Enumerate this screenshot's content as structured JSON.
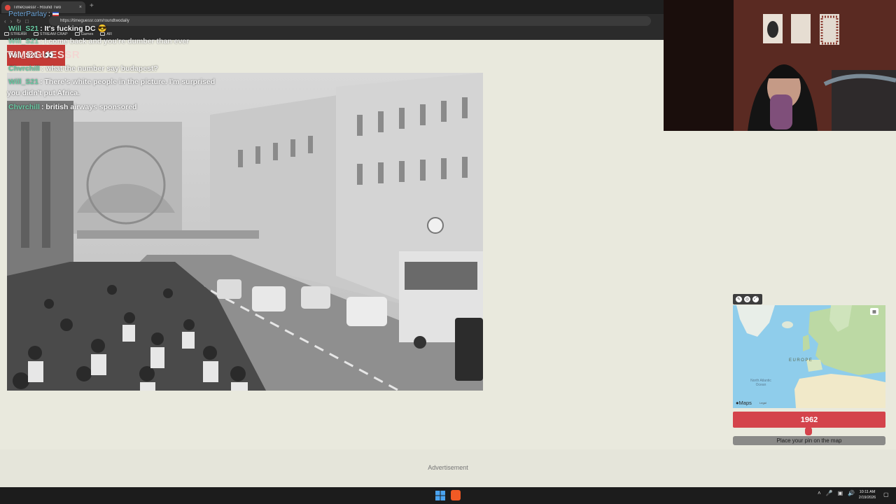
{
  "browser": {
    "tab_title": "TimeGuessr - Round Two",
    "tab_close": "×",
    "new_tab": "+",
    "url": "https://timeguessr.com/roundtwodaily",
    "bookmarks": [
      "STREAM",
      "STREAM CRAP",
      "Games",
      "AR"
    ]
  },
  "site": {
    "logo": "TIMEGUESSR"
  },
  "chat": [
    {
      "user": "PeterParlay",
      "text": ":",
      "user_color": "#6fa8dc"
    },
    {
      "user": "Will_S21",
      "text": ": It's fucking DC 😎",
      "user_color": "#69c9a3"
    },
    {
      "user": "Will_S21",
      "text": ": I come back and you're dumber than ever",
      "user_color": "#69c9a3"
    },
    {
      "user": "Will_S21",
      "text": ": 👀",
      "user_color": "#ffffff"
    },
    {
      "user": "Chvrchill",
      "text": ": what the number say budapest?",
      "user_color": "#69c9a3"
    },
    {
      "user": "Will_S21",
      "text": ": There's white people in the picture. I'm surprised",
      "user_color": "#69c9a3"
    },
    {
      "user": "",
      "text": "you didn't put Africa.",
      "user_color": "#ffffff"
    },
    {
      "user": "Chvrchill",
      "text": ": british airways sponsored",
      "user_color": "#69c9a3"
    }
  ],
  "map": {
    "brand": "Maps",
    "legal": "Legal",
    "region_label": "EUROPE",
    "ocean_label": "North Atlantic Ocean",
    "corner_icon": "layers-icon",
    "tool_icons": [
      "edit-icon",
      "target-icon",
      "fullscreen-icon"
    ]
  },
  "guess": {
    "year": "1962",
    "slider_fraction": 0.49,
    "place_pin_label": "Place your pin on the map"
  },
  "ad": {
    "label": "Advertisement"
  },
  "taskbar": {
    "time": "10:11 AM",
    "date": "2/19/2026"
  },
  "colors": {
    "accent_red": "#d4434b",
    "page_background": "#e9e9dd",
    "taskbar": "#1c1c1c"
  }
}
